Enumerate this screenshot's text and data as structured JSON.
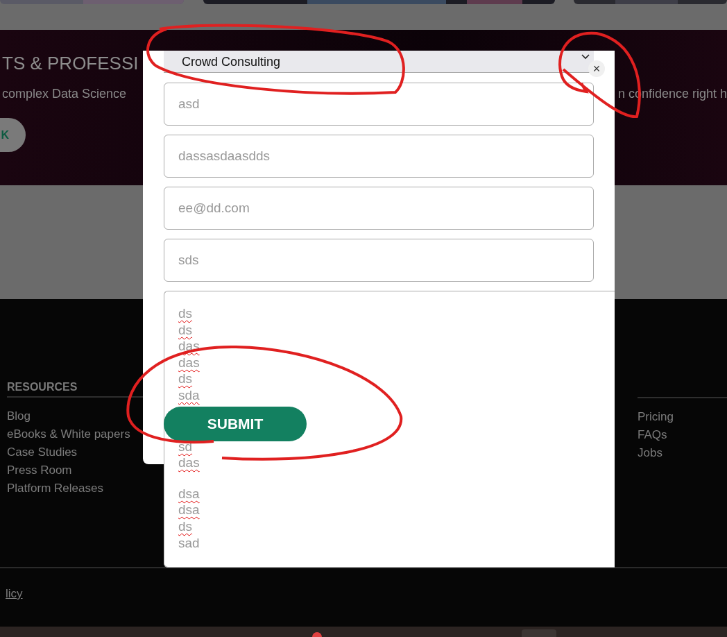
{
  "hero": {
    "heading": "TS & PROFESSI",
    "text_left": "complex Data Science",
    "text_right": "n confidence right h",
    "button": "K"
  },
  "footer": {
    "columns": [
      {
        "heading": "RESOURCES",
        "links": [
          "Blog",
          "eBooks & White papers",
          "Case Studies",
          "Press Room",
          "Platform Releases"
        ]
      },
      {
        "links": [
          "Pricing",
          "FAQs",
          "Jobs"
        ]
      }
    ],
    "bottom_link": "licy"
  },
  "modal": {
    "select": {
      "value": "Crowd Consulting"
    },
    "fields": [
      {
        "placeholder": "asd"
      },
      {
        "placeholder": "dassasdaasdds"
      },
      {
        "placeholder": "ee@dd.com"
      },
      {
        "placeholder": "sds"
      }
    ],
    "textarea": {
      "blocks": [
        [
          {
            "text": "ds",
            "misspelled": true
          },
          {
            "text": "ds",
            "misspelled": true
          },
          {
            "text": "das",
            "misspelled": true
          },
          {
            "text": "das",
            "misspelled": true
          },
          {
            "text": "ds",
            "misspelled": true
          },
          {
            "text": "sda",
            "misspelled": true
          }
        ],
        [
          {
            "text": "sd",
            "misspelled": true
          },
          {
            "text": "das",
            "misspelled": true
          }
        ],
        [
          {
            "text": "dsa",
            "misspelled": true
          },
          {
            "text": "dsa",
            "misspelled": true
          },
          {
            "text": "ds",
            "misspelled": true
          },
          {
            "text": "sad",
            "misspelled": false
          }
        ]
      ]
    },
    "submit": "SUBMIT",
    "close": "×"
  }
}
